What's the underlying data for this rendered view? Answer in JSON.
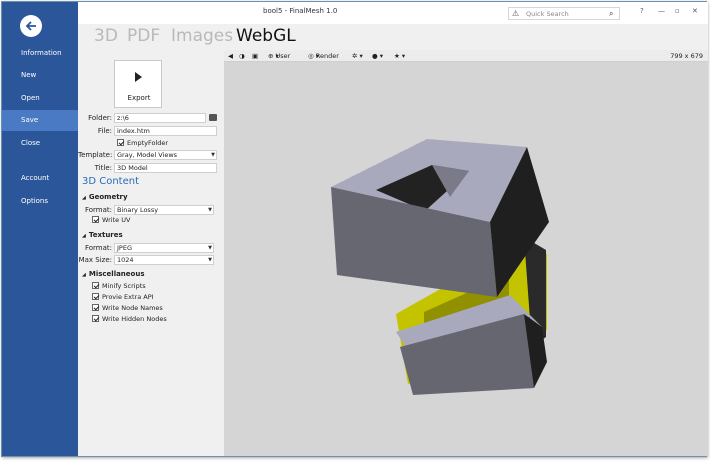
{
  "window": {
    "title": "bool5 - FinalMesh 1.0"
  },
  "search": {
    "placeholder": "Quick Search"
  },
  "window_controls": [
    "?",
    "—",
    "▫",
    "✕"
  ],
  "sidebar": {
    "items": [
      {
        "label": "Information"
      },
      {
        "label": "New"
      },
      {
        "label": "Open"
      },
      {
        "label": "Save",
        "selected": true
      },
      {
        "label": "Close"
      },
      {
        "label": "Account"
      },
      {
        "label": "Options"
      }
    ]
  },
  "tabs": [
    {
      "label": "3D"
    },
    {
      "label": "PDF"
    },
    {
      "label": "Images"
    },
    {
      "label": "WebGL",
      "active": true
    }
  ],
  "export": {
    "label": "Export"
  },
  "form": {
    "folder_label": "Folder:",
    "folder_value": "z:\\6",
    "file_label": "File:",
    "file_value": "index.htm",
    "empty_folder": "EmptyFolder",
    "template_label": "Template:",
    "template_value": "Gray, Model Views",
    "title_label": "Title:",
    "title_value": "3D Model"
  },
  "content_heading": "3D Content",
  "geometry": {
    "heading": "Geometry",
    "format_label": "Format:",
    "format_value": "Binary Lossy",
    "write_uv": "Write UV"
  },
  "textures": {
    "heading": "Textures",
    "format_label": "Format:",
    "format_value": "JPEG",
    "maxsize_label": "Max Size:",
    "maxsize_value": "1024"
  },
  "misc": {
    "heading": "Miscellaneous",
    "items": [
      "Minify Scripts",
      "Provie Extra API",
      "Write Node Names",
      "Write Hidden Nodes"
    ]
  },
  "viewer_toolbar": {
    "user_label": "User",
    "render_label": "Render",
    "dimensions": "799 x 679"
  },
  "colors": {
    "sidebar": "#2b579a",
    "sidebar_selected": "#4a7ac4",
    "accent": "#2b6cb5",
    "viewport": "#d5d5d5",
    "model_gray": "#9b9bb0",
    "model_yellow": "#c8c800"
  },
  "icons": [
    "back-arrow-icon",
    "warning-icon",
    "search-icon",
    "play-icon",
    "folder-icon",
    "camera-icon",
    "star-icon",
    "lightbulb-icon",
    "gear-icon"
  ]
}
